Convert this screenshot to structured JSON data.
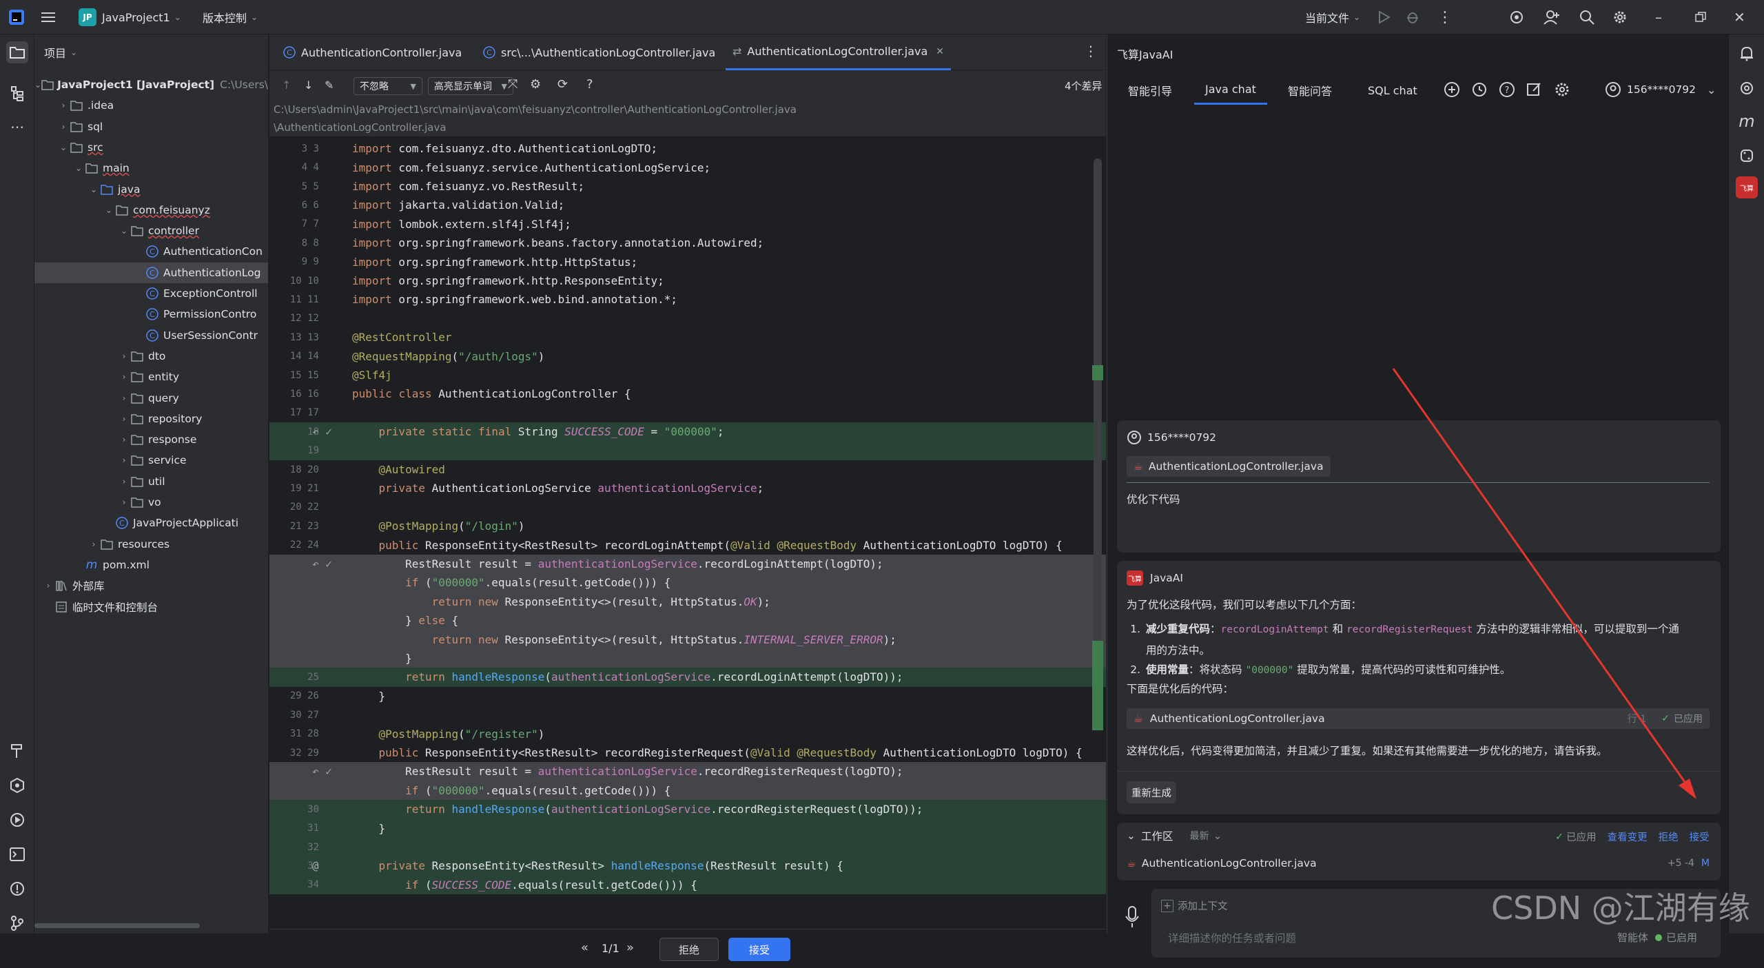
{
  "titlebar": {
    "project_badge": "JP",
    "project_name": "JavaProject1",
    "vcs": "版本控制",
    "run_config": "当前文件"
  },
  "project_panel": {
    "title": "项目",
    "tree": [
      {
        "label": "JavaProject1 [JavaProject]",
        "extra": "C:\\Users\\a",
        "icon": "module-folder-icon"
      },
      {
        "label": ".idea",
        "icon": "folder-icon"
      },
      {
        "label": "sql",
        "icon": "folder-icon"
      },
      {
        "label": "src",
        "icon": "folder-icon"
      },
      {
        "label": "main",
        "icon": "folder-icon"
      },
      {
        "label": "java",
        "icon": "source-folder-icon"
      },
      {
        "label": "com.feisuanyz",
        "icon": "package-icon"
      },
      {
        "label": "controller",
        "icon": "package-icon"
      },
      {
        "label": "AuthenticationCon",
        "icon": "class-icon"
      },
      {
        "label": "AuthenticationLog",
        "icon": "class-icon"
      },
      {
        "label": "ExceptionControll",
        "icon": "class-icon"
      },
      {
        "label": "PermissionContro",
        "icon": "class-icon"
      },
      {
        "label": "UserSessionContr",
        "icon": "class-icon"
      },
      {
        "label": "dto",
        "icon": "package-icon"
      },
      {
        "label": "entity",
        "icon": "package-icon"
      },
      {
        "label": "query",
        "icon": "package-icon"
      },
      {
        "label": "repository",
        "icon": "package-icon"
      },
      {
        "label": "response",
        "icon": "package-icon"
      },
      {
        "label": "service",
        "icon": "package-icon"
      },
      {
        "label": "util",
        "icon": "package-icon"
      },
      {
        "label": "vo",
        "icon": "package-icon"
      },
      {
        "label": "JavaProjectApplicati",
        "icon": "spring-class-icon"
      },
      {
        "label": "resources",
        "icon": "resources-folder-icon"
      },
      {
        "label": "pom.xml",
        "icon": "maven-icon"
      },
      {
        "label": "外部库",
        "icon": "library-icon"
      },
      {
        "label": "临时文件和控制台",
        "icon": "scratch-icon"
      }
    ]
  },
  "editor": {
    "tabs": [
      {
        "label": "AuthenticationController.java"
      },
      {
        "label": "src\\...\\AuthenticationLogController.java"
      },
      {
        "label": "AuthenticationLogController.java"
      }
    ],
    "ignore_dropdown": "不忽略",
    "highlight_dropdown": "高亮显示单词",
    "diff_count": "4个差异",
    "path_line1": "C:\\Users\\admin\\JavaProject1\\src\\main\\java\\com\\feisuanyz\\controller\\AuthenticationLogController.java",
    "path_line2": "\\AuthenticationLogController.java",
    "pager": "1/1",
    "reject_label": "拒绝",
    "accept_label": "接受"
  },
  "code_lines": [
    {
      "ln": "3 3",
      "t": "import com.feisuanyz.dto.AuthenticationLogDTO;"
    },
    {
      "ln": "4 4",
      "t": "import com.feisuanyz.service.AuthenticationLogService;"
    },
    {
      "ln": "5 5",
      "t": "import com.feisuanyz.vo.RestResult;"
    },
    {
      "ln": "6 6",
      "t": "import jakarta.validation.Valid;"
    },
    {
      "ln": "7 7",
      "t": "import lombok.extern.slf4j.Slf4j;"
    },
    {
      "ln": "8 8",
      "t": "import org.springframework.beans.factory.annotation.Autowired;"
    },
    {
      "ln": "9 9",
      "t": "import org.springframework.http.HttpStatus;"
    },
    {
      "ln": "10 10",
      "t": "import org.springframework.http.ResponseEntity;"
    },
    {
      "ln": "11 11",
      "t": "import org.springframework.web.bind.annotation.*;"
    },
    {
      "ln": "12 12",
      "t": ""
    },
    {
      "ln": "13 13",
      "t": "@RestController"
    },
    {
      "ln": "14 14",
      "t": "@RequestMapping(\"/auth/logs\")"
    },
    {
      "ln": "15 15",
      "t": "@Slf4j"
    },
    {
      "ln": "16 16",
      "t": "public class AuthenticationLogController {"
    },
    {
      "ln": "17 17",
      "t": ""
    },
    {
      "ln": "18",
      "t": "    private static final String SUCCESS_CODE = \"000000\";"
    },
    {
      "ln": "19",
      "t": ""
    },
    {
      "ln": "18 20",
      "t": "    @Autowired"
    },
    {
      "ln": "19 21",
      "t": "    private AuthenticationLogService authenticationLogService;"
    },
    {
      "ln": "20 22",
      "t": ""
    },
    {
      "ln": "21 23",
      "t": "    @PostMapping(\"/login\")"
    },
    {
      "ln": "22 24",
      "t": "    public ResponseEntity<RestResult> recordLoginAttempt(@Valid @RequestBody AuthenticationLogDTO logDTO) {"
    },
    {
      "ln": "",
      "t": "        RestResult result = authenticationLogService.recordLoginAttempt(logDTO);"
    },
    {
      "ln": "",
      "t": "        if (\"000000\".equals(result.getCode())) {"
    },
    {
      "ln": "",
      "t": "            return new ResponseEntity<>(result, HttpStatus.OK);"
    },
    {
      "ln": "",
      "t": "        } else {"
    },
    {
      "ln": "",
      "t": "            return new ResponseEntity<>(result, HttpStatus.INTERNAL_SERVER_ERROR);"
    },
    {
      "ln": "",
      "t": "        }"
    },
    {
      "ln": "25",
      "t": "        return handleResponse(authenticationLogService.recordLoginAttempt(logDTO));"
    },
    {
      "ln": "29 26",
      "t": "    }"
    },
    {
      "ln": "30 27",
      "t": ""
    },
    {
      "ln": "31 28",
      "t": "    @PostMapping(\"/register\")"
    },
    {
      "ln": "32 29",
      "t": "    public ResponseEntity<RestResult> recordRegisterRequest(@Valid @RequestBody AuthenticationLogDTO logDTO) {"
    },
    {
      "ln": "",
      "t": "        RestResult result = authenticationLogService.recordRegisterRequest(logDTO);"
    },
    {
      "ln": "",
      "t": "        if (\"000000\".equals(result.getCode())) {"
    },
    {
      "ln": "30",
      "t": "        return handleResponse(authenticationLogService.recordRegisterRequest(logDTO));"
    },
    {
      "ln": "31",
      "t": "    }"
    },
    {
      "ln": "32",
      "t": ""
    },
    {
      "ln": "33",
      "t": "    private ResponseEntity<RestResult> handleResponse(RestResult result) {"
    },
    {
      "ln": "34",
      "t": "        if (SUCCESS_CODE.equals(result.getCode())) {"
    }
  ],
  "ai_panel": {
    "title": "飞算JavaAI",
    "tabs": [
      "智能引导",
      "Java chat",
      "智能问答",
      "SQL chat"
    ],
    "account": "156****0792",
    "user_name": "156****0792",
    "attached_file": "AuthenticationLogController.java",
    "user_prompt": "优化下代码",
    "ai_badge": "飞算",
    "ai_name": "JavaAI",
    "intro": "为了优化这段代码，我们可以考虑以下几个方面：",
    "point1_title": "减少重复代码",
    "point1_m1": "recordLoginAttempt",
    "point1_and": "和",
    "point1_m2": "recordRegisterRequest",
    "point1_rest": "方法中的逻辑非常相似，可以提取到一个通",
    "point1_rest2": "用的方法中。",
    "point2_title": "使用常量",
    "point2_a": "将状态码",
    "point2_code": "\"000000\"",
    "point2_b": "提取为常量，提高代码的可读性和可维护性。",
    "code_intro": "下面是优化后的代码：",
    "code_file": "AuthenticationLogController.java",
    "code_file_applied": "已应用",
    "code_file_line": "行 1",
    "summary": "这样优化后，代码变得更加简洁，并且减少了重复。如果还有其他需要进一步优化的地方，请告诉我。",
    "regenerate": "重新生成",
    "workspace_title": "工作区",
    "workspace_sort": "最新",
    "ws_applied": "已应用",
    "ws_view": "查看变更",
    "ws_reject": "拒绝",
    "ws_accept": "接受",
    "ws_file": "AuthenticationLogController.java",
    "ws_diff": "+5 -4",
    "ws_mod": "M",
    "add_context": "添加上下文",
    "input_placeholder": "详细描述你的任务或者问题",
    "smart_agent": "智能体",
    "agent_status": "已启用"
  },
  "watermark": "CSDN @江湖有缘"
}
